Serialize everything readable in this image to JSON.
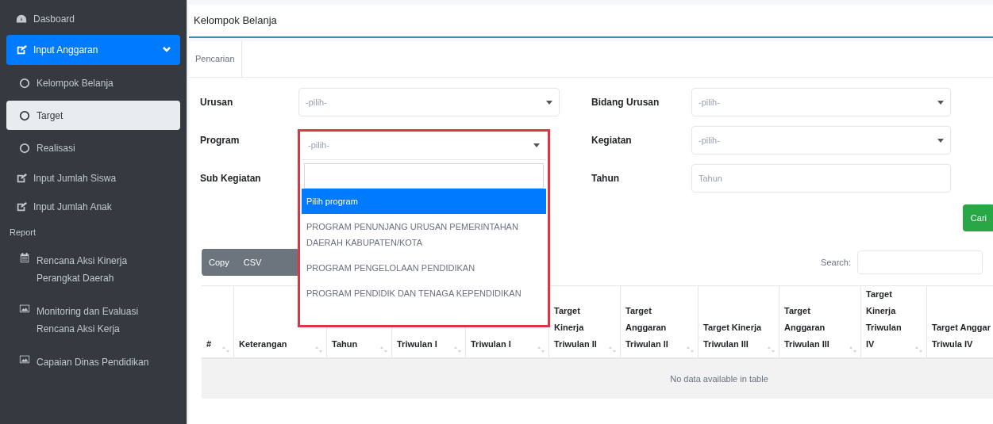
{
  "sidebar": {
    "items": [
      {
        "kind": "dashboard",
        "label": "Dasboard",
        "selected": false
      },
      {
        "kind": "group",
        "label": "Input Anggaran",
        "selected": true,
        "expanded": true
      },
      {
        "kind": "subitem",
        "label": "Kelompok Belanja",
        "selected": false
      },
      {
        "kind": "subitem",
        "label": "Target",
        "selected": true
      },
      {
        "kind": "subitem",
        "label": "Realisasi",
        "selected": false
      },
      {
        "kind": "link",
        "label": "Input Jumlah Siswa",
        "selected": false
      },
      {
        "kind": "link",
        "label": "Input Jumlah Anak",
        "selected": false
      },
      {
        "kind": "header",
        "label": "Report"
      },
      {
        "kind": "calendar",
        "label": "Rencana Aksi Kinerja Perangkat Daerah"
      },
      {
        "kind": "gallery",
        "label": "Monitoring dan Evaluasi Rencana Aksi Kerja"
      },
      {
        "kind": "gallery",
        "label": "Capaian Dinas Pendidikan"
      }
    ]
  },
  "page_title": "Kelompok Belanja",
  "tabs": [
    {
      "label": "Pencarian",
      "selected": true
    }
  ],
  "form": {
    "left": [
      {
        "label": "Urusan",
        "kind": "select",
        "value": "-pilih-"
      },
      {
        "label": "Program",
        "kind": "open"
      },
      {
        "label": "Sub Kegiatan",
        "kind": "covered"
      }
    ],
    "right": [
      {
        "label": "Bidang Urusan",
        "kind": "select",
        "value": "-pilih-"
      },
      {
        "label": "Kegiatan",
        "kind": "select",
        "value": "-pilih-"
      },
      {
        "label": "Tahun",
        "kind": "input",
        "placeholder": "Tahun"
      }
    ],
    "submit": "Cari"
  },
  "dropdown": {
    "value": "-pilih-",
    "options": [
      {
        "label": "Pilih program",
        "selected": true
      },
      {
        "label": "PROGRAM PENUNJANG URUSAN PEMERINTAHAN DAERAH KABUPATEN/KOTA",
        "selected": false
      },
      {
        "label": "PROGRAM PENGELOLAAN PENDIDIKAN",
        "selected": false
      },
      {
        "label": "PROGRAM PENDIDIK DAN TENAGA KEPENDIDIKAN",
        "selected": false
      }
    ]
  },
  "table": {
    "buttons": [
      "Copy",
      "CSV"
    ],
    "search_label": "Search:",
    "columns": [
      "#",
      "Keterangan",
      "Tahun",
      "Triwulan I",
      "Triwulan I",
      "Target Kinerja Triwulan II",
      "Target Anggaran Triwulan II",
      "Target Kinerja Triwulan III",
      "Target Anggaran Triwulan III",
      "Target Kinerja Triwulan IV",
      "Target Anggar Triwula IV"
    ],
    "empty_message": "No data available in table"
  }
}
